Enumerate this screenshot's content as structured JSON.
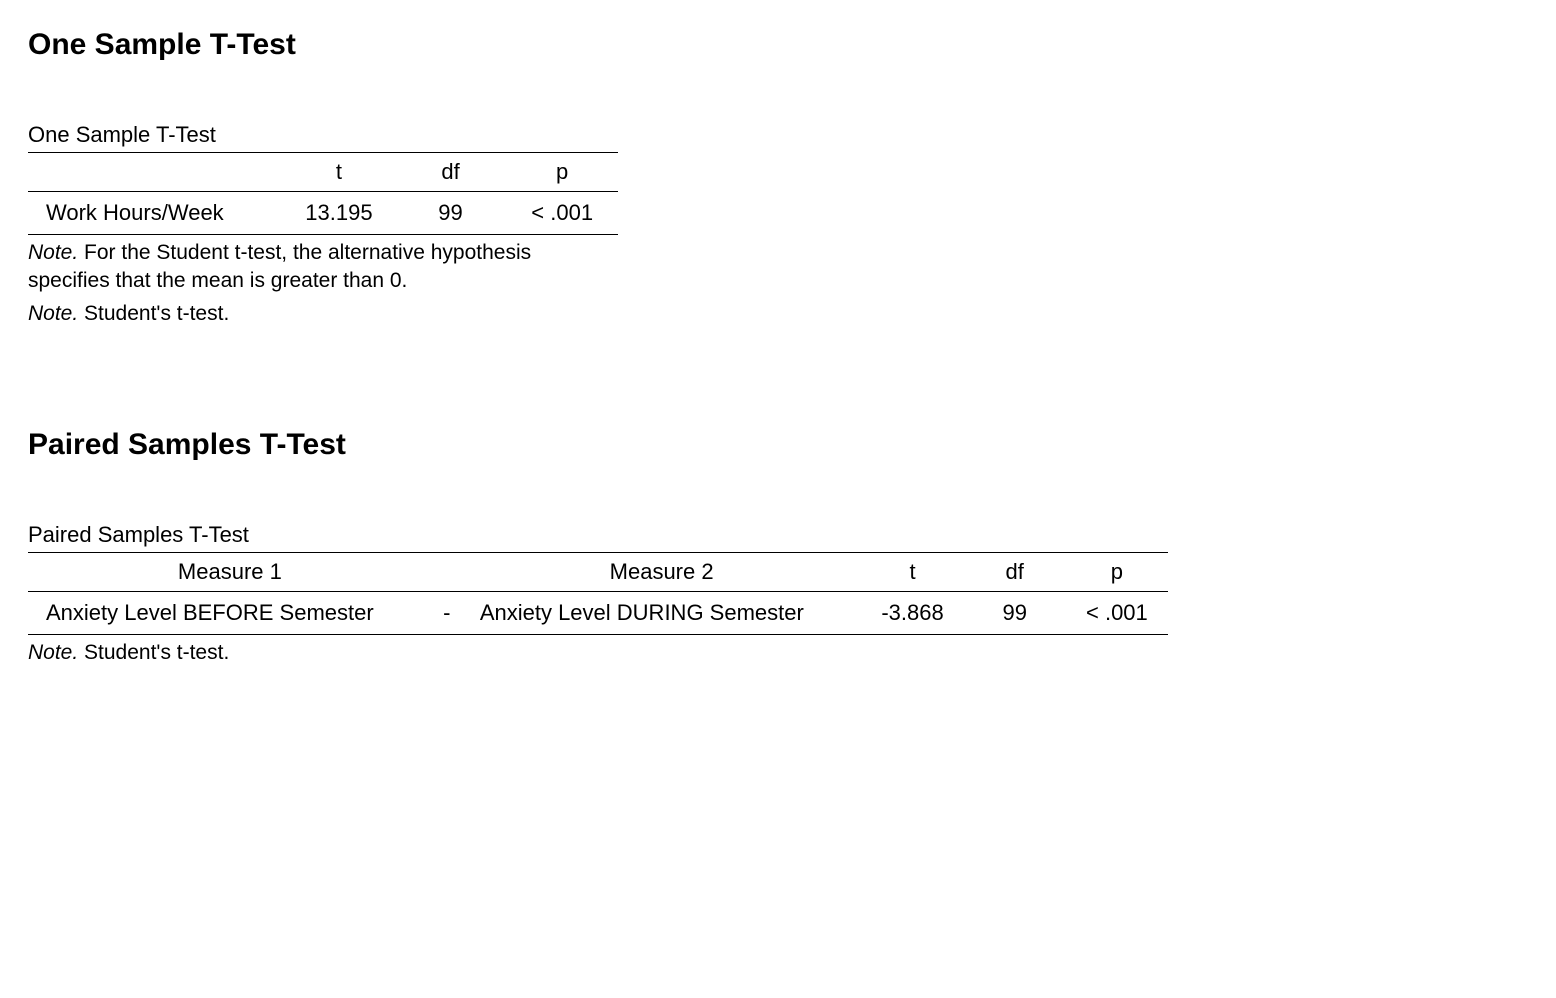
{
  "section1": {
    "heading": "One Sample T-Test",
    "table_caption": "One Sample T-Test",
    "headers": {
      "blank": "",
      "t": "t",
      "df": "df",
      "p": "p"
    },
    "row": {
      "label": "Work Hours/Week",
      "t": "13.195",
      "df": "99",
      "p": "< .001"
    },
    "note1_label": "Note.",
    "note1_text": " For the Student t-test, the alternative hypothesis specifies that the mean is greater than 0.",
    "note2_label": "Note.",
    "note2_text": " Student's t-test."
  },
  "section2": {
    "heading": "Paired Samples T-Test",
    "table_caption": "Paired Samples T-Test",
    "headers": {
      "m1": "Measure 1",
      "dash": "",
      "m2": "Measure 2",
      "t": "t",
      "df": "df",
      "p": "p"
    },
    "row": {
      "m1": "Anxiety Level BEFORE Semester",
      "dash": "-",
      "m2": "Anxiety Level DURING Semester",
      "t": "-3.868",
      "df": "99",
      "p": "< .001"
    },
    "note_label": "Note.",
    "note_text": " Student's t-test."
  }
}
